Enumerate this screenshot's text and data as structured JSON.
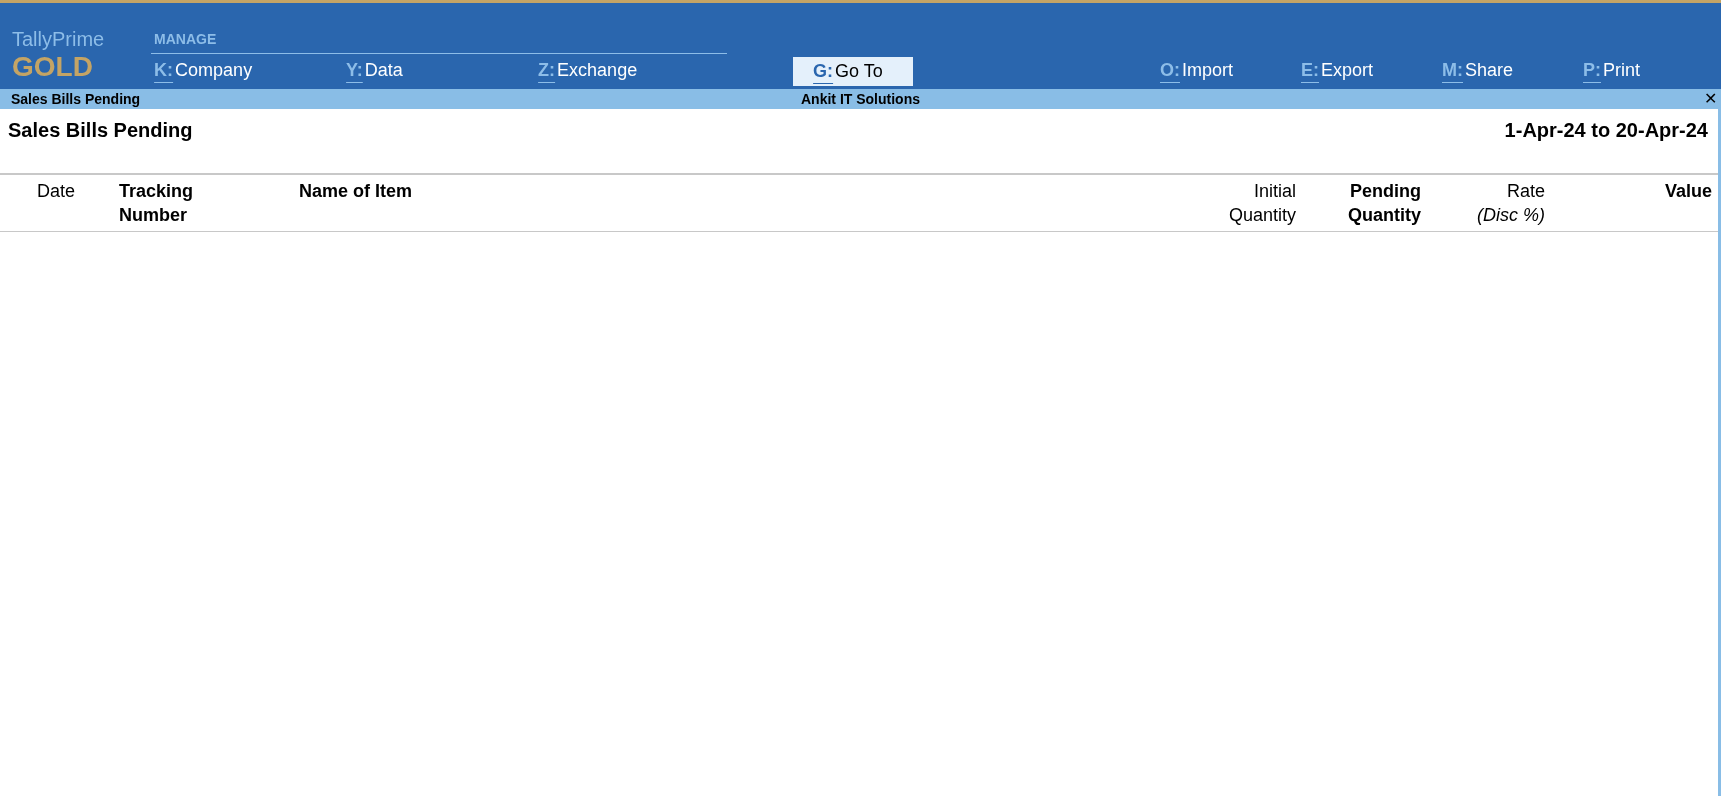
{
  "brand": {
    "product": "TallyPrime",
    "edition": "GOLD"
  },
  "menu": {
    "group_label": "MANAGE",
    "left_items": [
      {
        "key": "K:",
        "label": "Company"
      },
      {
        "key": "Y:",
        "label": "Data"
      },
      {
        "key": "Z:",
        "label": "Exchange"
      }
    ],
    "goto": {
      "key": "G:",
      "label": "Go To",
      "highlighted": true
    },
    "right_items": [
      {
        "key": "O:",
        "label": "Import"
      },
      {
        "key": "E:",
        "label": "Export"
      },
      {
        "key": "M:",
        "label": "Share"
      },
      {
        "key": "P:",
        "label": "Print"
      }
    ]
  },
  "title_bar": {
    "screen": "Sales Bills Pending",
    "company": "Ankit IT Solutions",
    "close": "✕"
  },
  "report": {
    "title": "Sales Bills Pending",
    "period": "1-Apr-24 to 20-Apr-24"
  },
  "columns": [
    {
      "lines": [
        {
          "text": "Date",
          "kind": "plain"
        }
      ]
    },
    {
      "lines": [
        {
          "text": "Tracking",
          "kind": "strong"
        },
        {
          "text": "Number",
          "kind": "strong"
        }
      ]
    },
    {
      "lines": [
        {
          "text": "Name of Item",
          "kind": "strong"
        }
      ]
    },
    {
      "lines": [
        {
          "text": "Initial",
          "kind": "plain"
        },
        {
          "text": "Quantity",
          "kind": "plain"
        }
      ]
    },
    {
      "lines": [
        {
          "text": "Pending",
          "kind": "strong"
        },
        {
          "text": "Quantity",
          "kind": "strong"
        }
      ]
    },
    {
      "lines": [
        {
          "text": "Rate",
          "kind": "plain"
        },
        {
          "text": "(Disc %)",
          "kind": "note"
        }
      ]
    },
    {
      "lines": [
        {
          "text": "Value",
          "kind": "strong"
        }
      ]
    }
  ]
}
